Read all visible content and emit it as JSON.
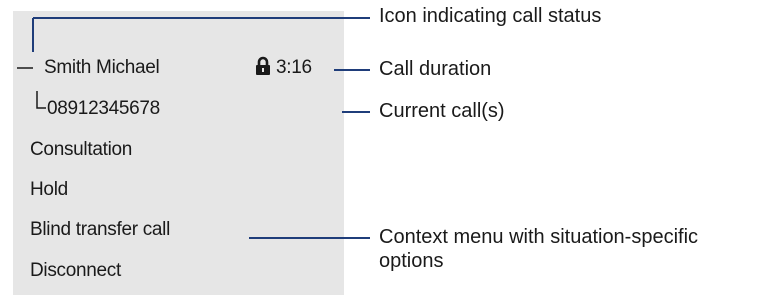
{
  "display": {
    "caller_name": "Smith Michael",
    "call_duration": "3:16",
    "caller_number": "08912345678",
    "menu_items": [
      "Consultation",
      "Hold",
      "Blind transfer call",
      "Disconnect"
    ]
  },
  "callouts": {
    "call_status_icon": "Icon indicating call status",
    "call_duration": "Call duration",
    "current_calls": "Current call(s)",
    "context_menu_line1": "Context menu with situation-specific",
    "context_menu_line2": "options"
  },
  "icons": {
    "secure_call": "lock-icon"
  },
  "colors": {
    "leader_line": "#1f3d7a",
    "display_background": "#e6e6e6"
  }
}
